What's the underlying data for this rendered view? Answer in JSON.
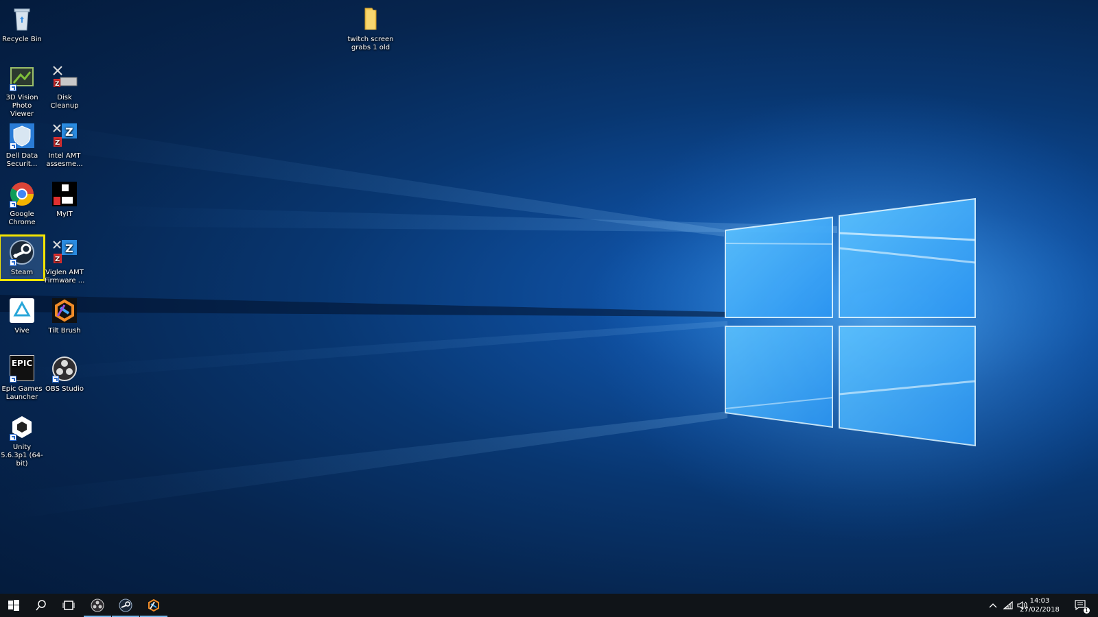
{
  "desktop": {
    "icons": [
      {
        "id": "recycle-bin",
        "label": "Recycle Bin",
        "icon": "recycle-bin-icon"
      },
      {
        "id": "twitch-folder",
        "label": "twitch screen grabs 1 old",
        "icon": "folder-icon"
      },
      {
        "id": "3d-vision",
        "label": "3D Vision Photo Viewer",
        "icon": "3d-vision-icon"
      },
      {
        "id": "disk-cleanup",
        "label": "Disk Cleanup",
        "icon": "disk-cleanup-icon"
      },
      {
        "id": "dell-data",
        "label": "Dell Data Securit...",
        "icon": "dell-shield-icon"
      },
      {
        "id": "intel-amt",
        "label": "Intel AMT assesme...",
        "icon": "intel-amt-icon"
      },
      {
        "id": "google-chrome",
        "label": "Google Chrome",
        "icon": "chrome-icon"
      },
      {
        "id": "myit",
        "label": "MyIT",
        "icon": "myit-icon"
      },
      {
        "id": "steam",
        "label": "Steam",
        "icon": "steam-icon",
        "selected": true
      },
      {
        "id": "viglen-amt",
        "label": "Viglen AMT Firmware ...",
        "icon": "viglen-amt-icon"
      },
      {
        "id": "vive",
        "label": "Vive",
        "icon": "vive-icon"
      },
      {
        "id": "tilt-brush",
        "label": "Tilt Brush",
        "icon": "tilt-brush-icon"
      },
      {
        "id": "epic-games",
        "label": "Epic Games Launcher",
        "icon": "epic-games-icon",
        "badge": "EPIC"
      },
      {
        "id": "obs-studio",
        "label": "OBS Studio",
        "icon": "obs-icon"
      },
      {
        "id": "unity",
        "label": "Unity 5.6.3p1 (64-bit)",
        "icon": "unity-icon"
      }
    ]
  },
  "taskbar": {
    "start": "windows-start-icon",
    "search": "search-icon",
    "task_view": "task-view-icon",
    "apps": [
      {
        "name": "obs-icon",
        "active": true
      },
      {
        "name": "steam-icon",
        "active": true
      },
      {
        "name": "tilt-brush-icon",
        "active": true
      }
    ],
    "tray": {
      "chevron": "chevron-up-icon",
      "network": "wifi-icon",
      "volume": "speaker-icon"
    },
    "clock": {
      "time": "14:03",
      "date": "27/02/2018"
    },
    "notifications": {
      "icon": "action-center-icon",
      "count": "1"
    }
  },
  "colors": {
    "accent": "#76b9ed",
    "selection": "#f5e500",
    "taskbar": "#101418"
  }
}
